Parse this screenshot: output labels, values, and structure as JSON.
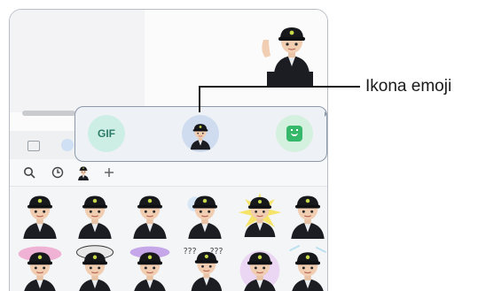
{
  "popup": {
    "gif_label": "GIF"
  },
  "callout": {
    "label": "Ikona emoji"
  },
  "toolbar": {
    "search_icon": "search-icon",
    "recent_icon": "clock-icon",
    "avatar_icon": "avatar-icon",
    "add_icon": "plus-icon"
  },
  "colors": {
    "frame_border": "#b9bec6",
    "popup_border": "#8d99a8",
    "gif_bg": "#cdeee5",
    "emoji_bg": "#cfdcf0",
    "sticker_bg": "#d4f0de",
    "sticker_accent": "#36b86a"
  }
}
